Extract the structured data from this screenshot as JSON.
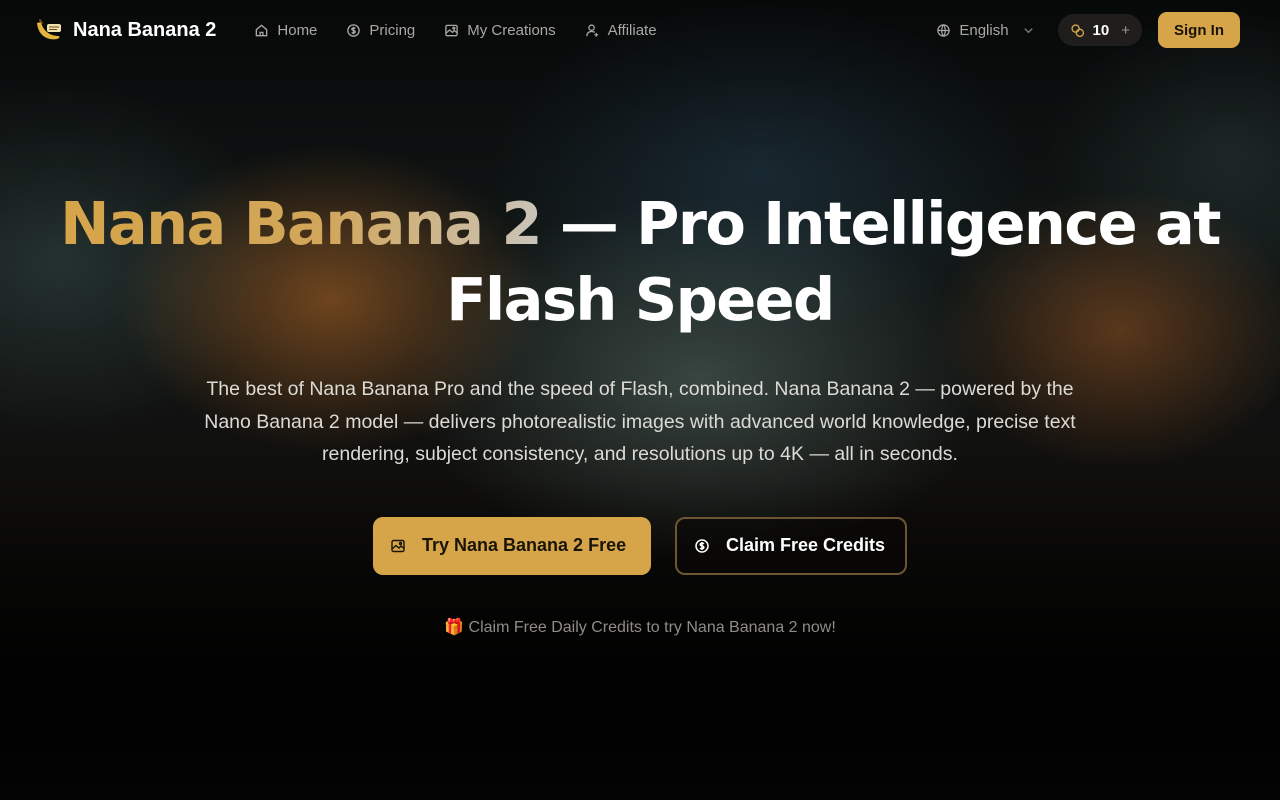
{
  "brand": {
    "name": "Nana Banana 2",
    "logo_icon": "banana-logo-icon"
  },
  "nav": {
    "links": [
      {
        "label": "Home",
        "icon": "home-icon"
      },
      {
        "label": "Pricing",
        "icon": "dollar-circle-icon"
      },
      {
        "label": "My Creations",
        "icon": "gallery-icon"
      },
      {
        "label": "Affiliate",
        "icon": "user-affiliate-icon"
      }
    ],
    "language": "English",
    "credits": {
      "count": "10",
      "add_symbol": "+"
    },
    "signin_label": "Sign In"
  },
  "hero": {
    "title_accent": "Nana Banana 2",
    "title_rest": " — Pro Intelligence at Flash Speed",
    "description": "The best of Nana Banana Pro and the speed of Flash, combined. Nana Banana 2 — powered by the Nano Banana 2 model — delivers photorealistic images with advanced world knowledge, precise text rendering, subject consistency, and resolutions up to 4K — all in seconds.",
    "primary_cta": "Try Nana Banana 2 Free",
    "secondary_cta": "Claim Free Credits",
    "promo": "🎁 Claim Free Daily Credits to try Nana Banana 2 now!"
  },
  "colors": {
    "accent": "#d6a54a",
    "background": "#070605",
    "muted_text": "#a9a7a2"
  }
}
